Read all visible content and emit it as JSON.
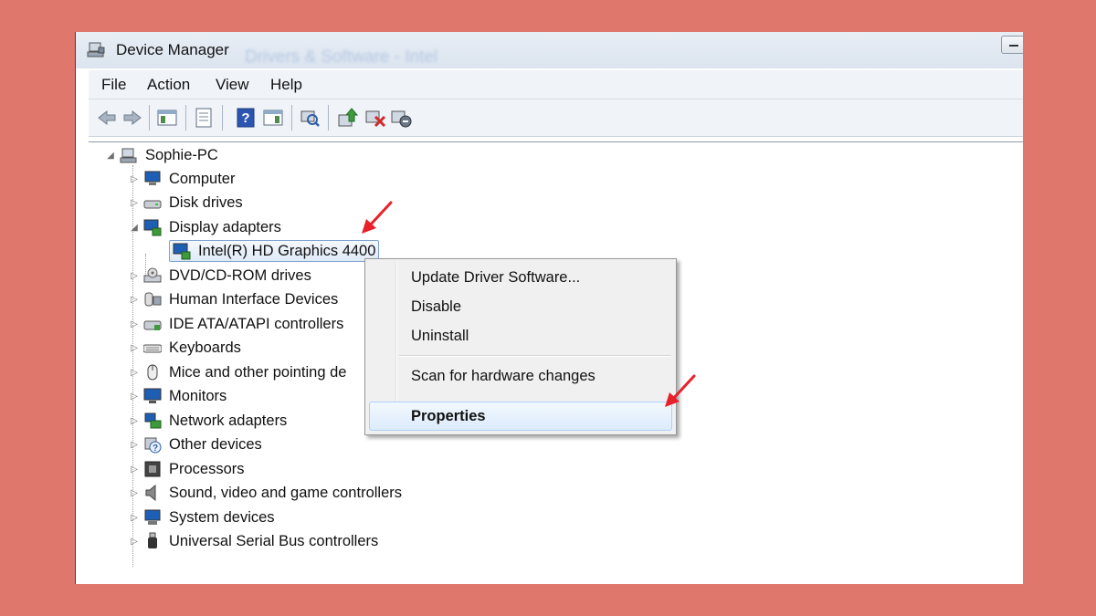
{
  "window": {
    "title": "Device Manager",
    "background_title": "Drivers & Software - Intel"
  },
  "menu": [
    "File",
    "Action",
    "View",
    "Help"
  ],
  "toolbar_icons": [
    "back-icon",
    "forward-icon",
    "show-hide-console-tree-icon",
    "properties-icon",
    "help-icon",
    "action-pane-icon",
    "scan-hardware-changes-icon",
    "update-driver-icon",
    "disable-device-icon",
    "uninstall-device-icon"
  ],
  "tree": {
    "root": "Sophie-PC",
    "items": [
      {
        "label": "Computer",
        "icon": "computer-icon"
      },
      {
        "label": "Disk drives",
        "icon": "disk-drive-icon"
      },
      {
        "label": "Display adapters",
        "icon": "display-adapter-icon",
        "expanded": true
      },
      {
        "label": "Intel(R) HD Graphics 4400",
        "icon": "display-adapter-icon",
        "child": true,
        "selected": true
      },
      {
        "label": "DVD/CD-ROM drives",
        "icon": "dvd-drive-icon"
      },
      {
        "label": "Human Interface Devices",
        "icon": "hid-icon"
      },
      {
        "label": "IDE ATA/ATAPI controllers",
        "icon": "ide-controller-icon"
      },
      {
        "label": "Keyboards",
        "icon": "keyboard-icon"
      },
      {
        "label": "Mice and other pointing de",
        "icon": "mouse-icon"
      },
      {
        "label": "Monitors",
        "icon": "monitor-icon"
      },
      {
        "label": "Network adapters",
        "icon": "network-adapter-icon"
      },
      {
        "label": "Other devices",
        "icon": "other-devices-icon"
      },
      {
        "label": "Processors",
        "icon": "processor-icon"
      },
      {
        "label": "Sound, video and game controllers",
        "icon": "speaker-icon"
      },
      {
        "label": "System devices",
        "icon": "system-devices-icon"
      },
      {
        "label": "Universal Serial Bus controllers",
        "icon": "usb-icon"
      }
    ]
  },
  "context_menu": {
    "items": [
      "Update Driver Software...",
      "Disable",
      "Uninstall",
      "Scan for hardware changes",
      "Properties"
    ],
    "highlighted": "Properties"
  },
  "colors": {
    "background": "#df776c",
    "annotation_arrow": "#e8202a",
    "selection": "#dfeaf7"
  }
}
